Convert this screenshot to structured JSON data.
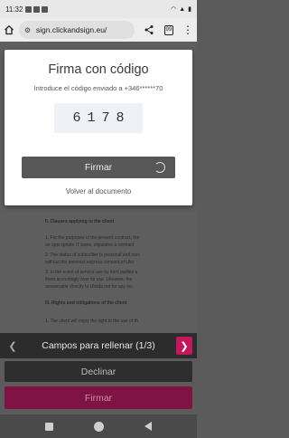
{
  "status_bar": {
    "time": "11:32",
    "battery_icon": "battery-icon",
    "wifi_icon": "wifi-icon",
    "signal_icon": "signal-icon"
  },
  "browser": {
    "url": "sign.clickandsign.eu/",
    "tab_count": "99",
    "home_icon": "home-icon",
    "share_icon": "share-icon",
    "menu_icon": "more-vert-icon"
  },
  "modal": {
    "title": "Firma con código",
    "subtitle": "Introduce el código enviado a +346******70",
    "code": "6178",
    "submit_label": "Firmar",
    "back_link": "Volver al documento"
  },
  "document": {
    "lines": [
      {
        "text": "II. Clauses applying to the client",
        "head": true
      },
      {
        "text": "1.    For the purposes of the present contract, the",
        "head": false
      },
      {
        "text": "       an appropriate IT basis, stipulates a contract",
        "head": false
      },
      {
        "text": "2.    The status of subscriber is personal and non-",
        "head": false
      },
      {
        "text": "       without the previous express consent of Ulei",
        "head": false
      },
      {
        "text": "3.    In the event of service use by third parties a",
        "head": false
      },
      {
        "text": "       them accordingly over its use. Likewise, the",
        "head": false
      },
      {
        "text": "       answerable directly to Uleida.net for any inc",
        "head": false
      },
      {
        "text": "III. Rights and obligations of the client",
        "head": true
      },
      {
        "text": "1.    The client will enjoy the right to the use of th",
        "head": false
      }
    ]
  },
  "fields_bar": {
    "label": "Campos para rellenar (1/3)",
    "prev_icon": "chevron-left-icon",
    "next_icon": "chevron-right-icon"
  },
  "actions": {
    "decline_label": "Declinar",
    "sign_label": "Firmar"
  },
  "colors": {
    "accent": "#c2185b",
    "sign_button": "#7e1344"
  }
}
